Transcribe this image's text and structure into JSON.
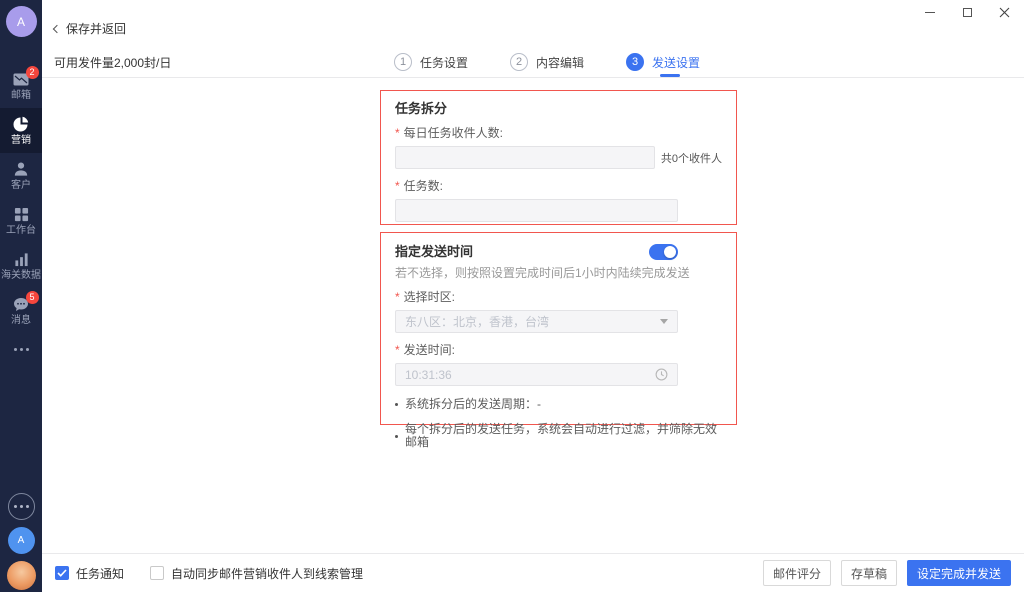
{
  "colors": {
    "accent": "#3b73f0",
    "danger": "#f1564e",
    "sidebar_bg": "#1d2642",
    "badge_red": "#f5463d"
  },
  "sidebar": {
    "top_avatar": "A",
    "items": [
      {
        "icon": "mail-icon",
        "label": "邮箱",
        "badge": "2",
        "active": false
      },
      {
        "icon": "pie-chart-icon",
        "label": "营销",
        "active": true
      },
      {
        "icon": "person-icon",
        "label": "客户",
        "active": false
      },
      {
        "icon": "grid-icon",
        "label": "工作台",
        "active": false
      },
      {
        "icon": "bar-chart-icon",
        "label": "海关数据",
        "active": false
      },
      {
        "icon": "chat-icon",
        "label": "消息",
        "badge": "5",
        "active": false
      },
      {
        "icon": "ellipsis-icon",
        "label": "",
        "active": false
      }
    ],
    "bottom": {
      "more_icon": "ellipsis-circle-icon",
      "avatar_label": "A",
      "photo": "profile-photo"
    }
  },
  "header": {
    "back_label": "保存并返回"
  },
  "subheader": {
    "quota": "可用发件量2,000封/日",
    "steps": [
      {
        "num": "1",
        "label": "任务设置",
        "active": false
      },
      {
        "num": "2",
        "label": "内容编辑",
        "active": false
      },
      {
        "num": "3",
        "label": "发送设置",
        "active": true
      }
    ]
  },
  "form": {
    "required_mark": "*",
    "task_split": {
      "title": "任务拆分",
      "daily_recipients_label": "每日任务收件人数:",
      "daily_recipients_value": "",
      "daily_recipients_suffix": "共0个收件人",
      "task_count_label": "任务数:",
      "task_count_value": ""
    },
    "send_time": {
      "title": "指定发送时间",
      "toggle_on": true,
      "description": "若不选择，则按照设置完成时间后1小时内陆续完成发送",
      "timezone_label": "选择时区:",
      "timezone_value": "东八区：北京，香港，台湾",
      "time_label": "发送时间:",
      "time_value": "10:31:36",
      "notes": [
        "系统拆分后的发送周期：-",
        "每个拆分后的发送任务，系统会自动进行过滤，并筛除无效邮箱"
      ]
    }
  },
  "footer": {
    "task_notify": {
      "label": "任务通知",
      "checked": true
    },
    "auto_sync": {
      "label": "自动同步邮件营销收件人到线索管理",
      "checked": false
    },
    "buttons": {
      "score": "邮件评分",
      "draft": "存草稿",
      "primary": "设定完成并发送"
    }
  }
}
